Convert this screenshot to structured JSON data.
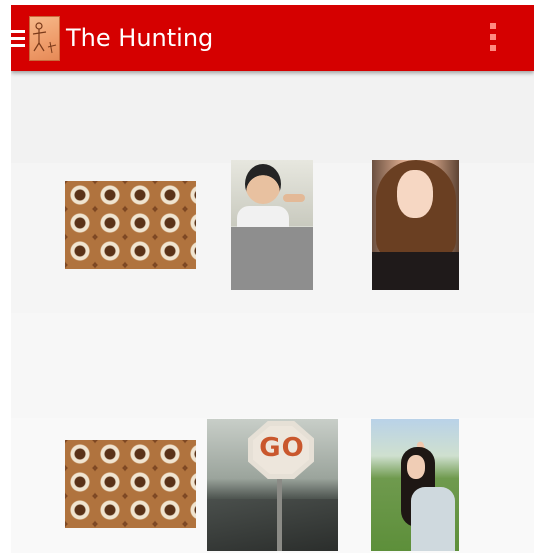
{
  "app_bar": {
    "title": "The Hunting",
    "background_color": "#d50000",
    "menu_icon": "hamburger-menu-icon",
    "overflow_icon": "vertical-dots-icon"
  },
  "gallery": {
    "images": [
      {
        "subject": "donuts",
        "row": 1,
        "column": 1
      },
      {
        "subject": "child",
        "row": 1,
        "column": 2
      },
      {
        "subject": "woman-portrait",
        "row": 1,
        "column": 3
      },
      {
        "subject": "donuts",
        "row": 2,
        "column": 1
      },
      {
        "subject": "go-sign",
        "row": 2,
        "column": 2
      },
      {
        "subject": "woman-outdoors",
        "row": 2,
        "column": 3
      }
    ],
    "sign_text": "GO"
  }
}
